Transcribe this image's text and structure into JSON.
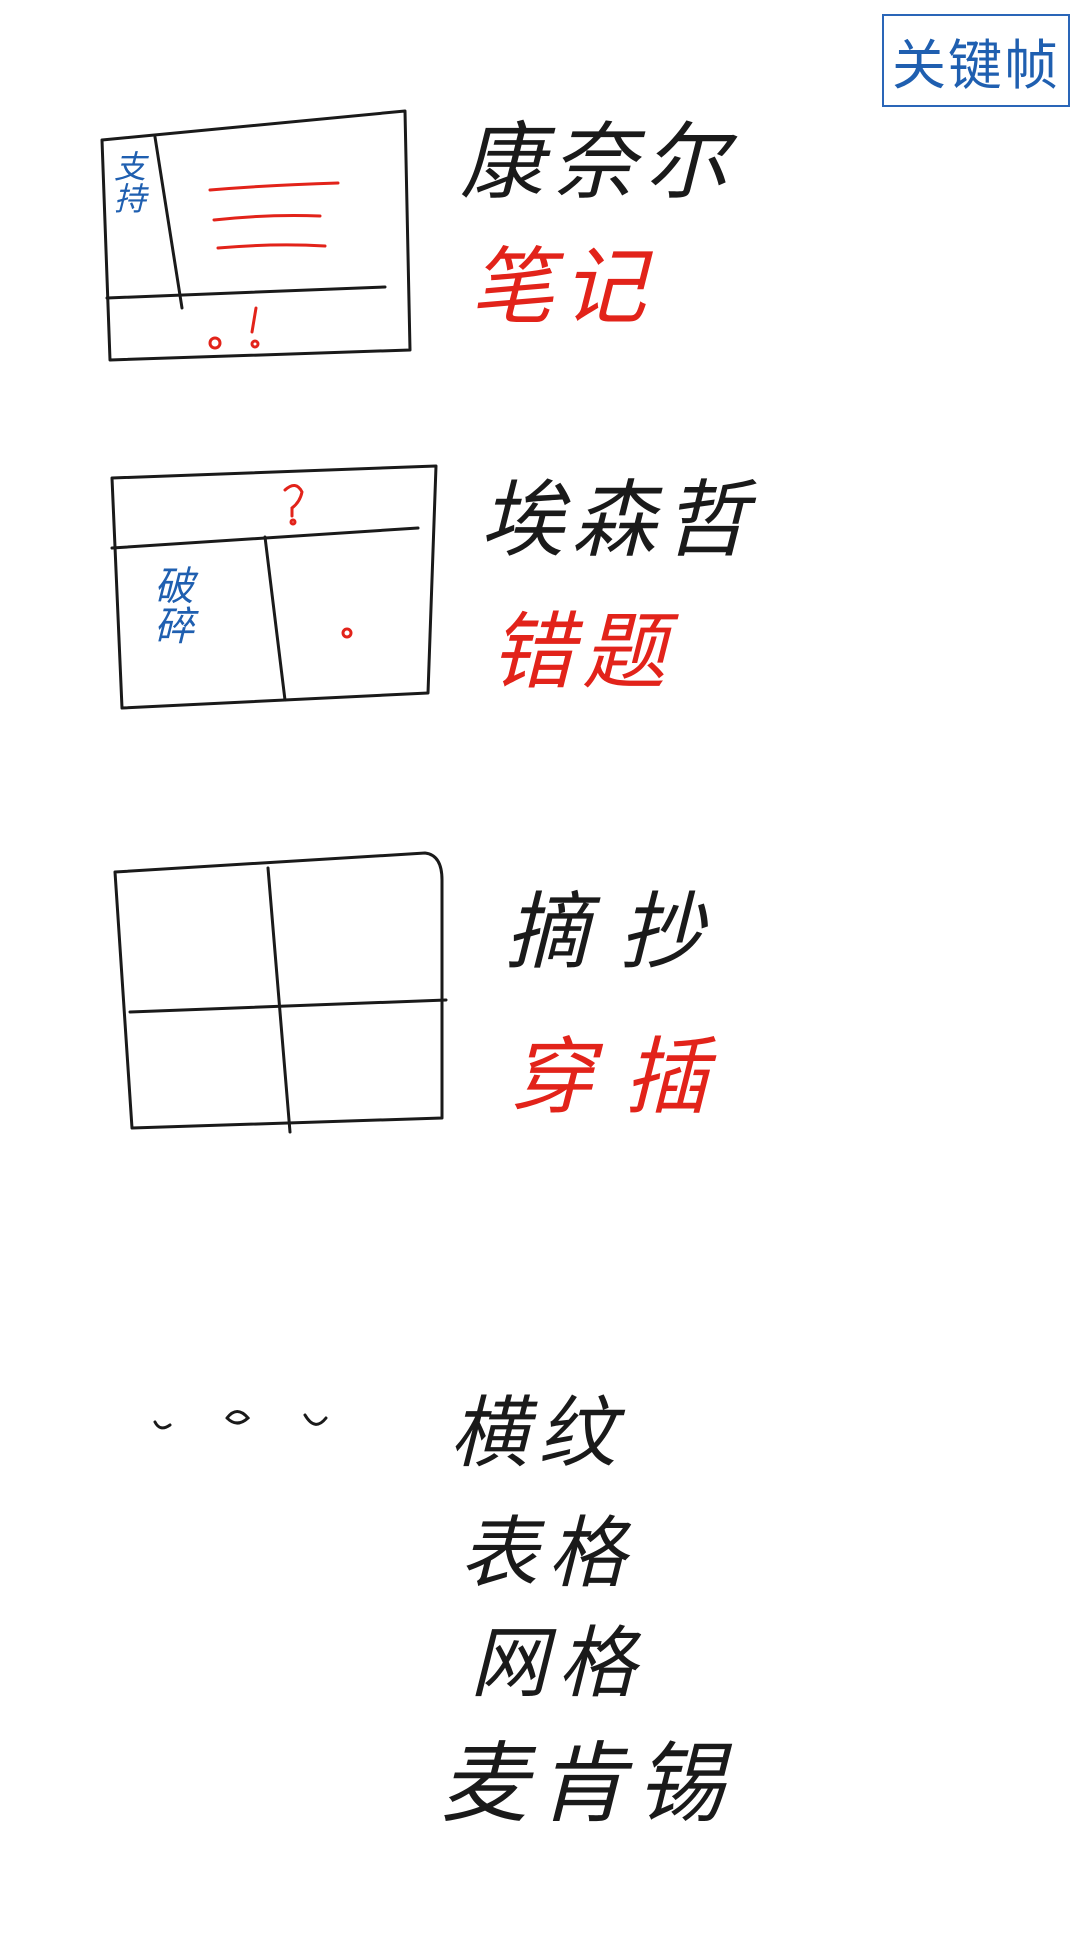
{
  "keyword_box": {
    "label": "关键帧"
  },
  "layouts": [
    {
      "name": "康奈尔",
      "method": "笔记",
      "sidebar_label": "支持",
      "marks": "!"
    },
    {
      "name": "埃森哲",
      "method": "错题",
      "cell_label": "破碎",
      "marks": "?"
    },
    {
      "name": "摘抄",
      "method": "穿插"
    }
  ],
  "more": {
    "ellipsis": "。。。",
    "items": [
      "横纹",
      "表格",
      "网格",
      "麦肯锡"
    ]
  },
  "colors": {
    "ink": "#1a1a1a",
    "accent_red": "#e2231a",
    "accent_blue": "#1f5fb0"
  }
}
